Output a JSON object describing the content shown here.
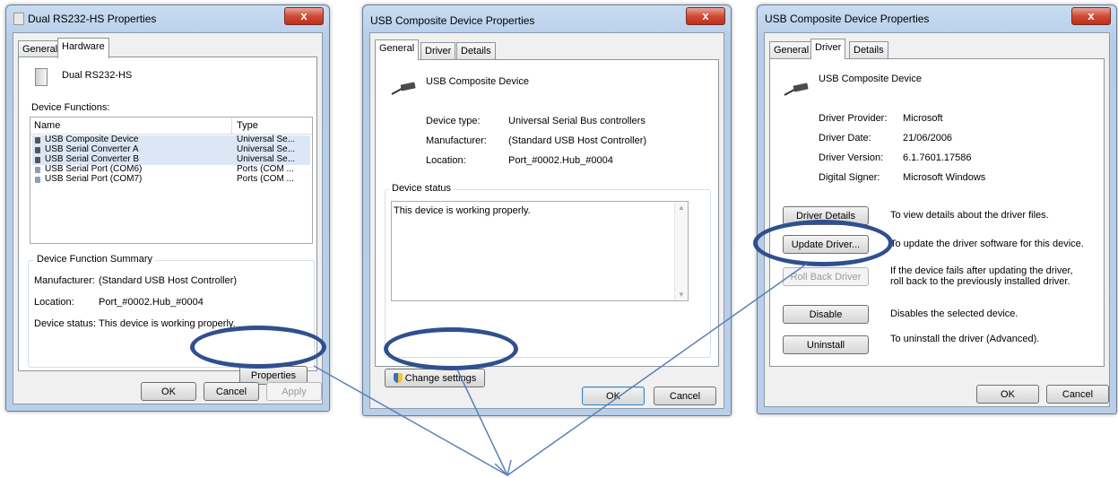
{
  "dialog1": {
    "title": "Dual RS232-HS Properties",
    "close": "x",
    "tabs": [
      "General",
      "Hardware"
    ],
    "device_name": "Dual RS232-HS",
    "functions_label": "Device Functions:",
    "col_name": "Name",
    "col_type": "Type",
    "rows": [
      {
        "name": "USB Composite Device",
        "type": "Universal Se..."
      },
      {
        "name": "USB Serial Converter A",
        "type": "Universal Se..."
      },
      {
        "name": "USB Serial Converter B",
        "type": "Universal Se..."
      },
      {
        "name": "USB Serial Port (COM6)",
        "type": "Ports (COM ..."
      },
      {
        "name": "USB Serial Port (COM7)",
        "type": "Ports (COM ..."
      }
    ],
    "summary_label": "Device Function Summary",
    "manufacturer_label": "Manufacturer:",
    "manufacturer_value": "(Standard USB Host Controller)",
    "location_label": "Location:",
    "location_value": "Port_#0002.Hub_#0004",
    "status_label": "Device status:",
    "status_value": "This device is working properly.",
    "properties_button": "Properties",
    "ok": "OK",
    "cancel": "Cancel",
    "apply": "Apply"
  },
  "dialog2": {
    "title": "USB Composite Device Properties",
    "close": "x",
    "tabs": [
      "General",
      "Driver",
      "Details"
    ],
    "device_name": "USB Composite Device",
    "type_label": "Device type:",
    "type_value": "Universal Serial Bus controllers",
    "manufacturer_label": "Manufacturer:",
    "manufacturer_value": "(Standard USB Host Controller)",
    "location_label": "Location:",
    "location_value": "Port_#0002.Hub_#0004",
    "status_group": "Device status",
    "status_text": "This device is working properly.",
    "change_settings": "Change settings",
    "ok": "OK",
    "cancel": "Cancel"
  },
  "dialog3": {
    "title": "USB Composite Device Properties",
    "close": "x",
    "tabs": [
      "General",
      "Driver",
      "Details"
    ],
    "device_name": "USB Composite Device",
    "provider_label": "Driver Provider:",
    "provider_value": "Microsoft",
    "date_label": "Driver Date:",
    "date_value": "21/06/2006",
    "version_label": "Driver Version:",
    "version_value": "6.1.7601.17586",
    "signer_label": "Digital Signer:",
    "signer_value": "Microsoft Windows",
    "actions": [
      {
        "button": "Driver Details",
        "desc": "To view details about the driver files."
      },
      {
        "button": "Update Driver...",
        "desc": "To update the driver software for this device."
      },
      {
        "button": "Roll Back Driver",
        "desc": "If the device fails after updating the driver, roll back to the previously installed driver."
      },
      {
        "button": "Disable",
        "desc": "Disables the selected device."
      },
      {
        "button": "Uninstall",
        "desc": "To uninstall the driver (Advanced)."
      }
    ],
    "ok": "OK",
    "cancel": "Cancel"
  },
  "colors": {
    "callout": "#2f4f8f",
    "arrow": "#5b7fb8",
    "selection": "#dce7f5"
  }
}
